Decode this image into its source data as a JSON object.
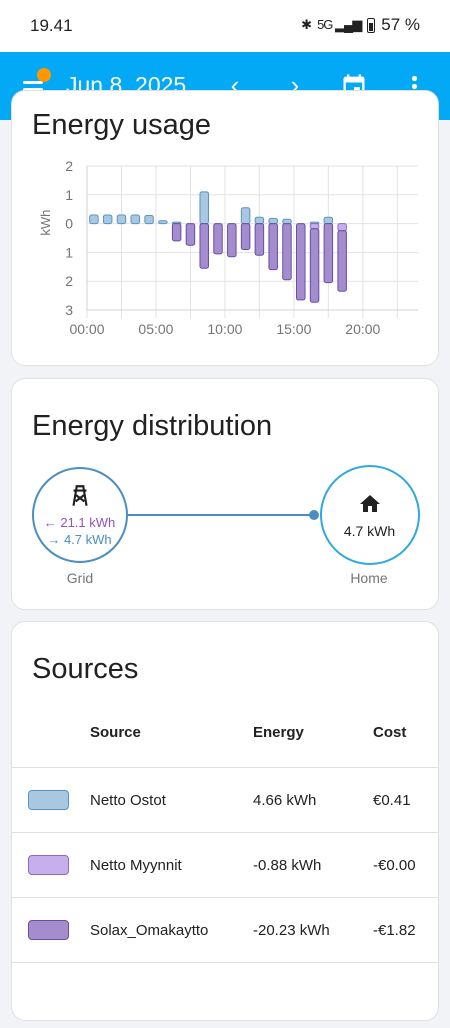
{
  "status_bar": {
    "time": "19.41",
    "network": "5G",
    "battery": "57 %"
  },
  "app_bar": {
    "date": "Jun 8, 2025",
    "prev": "‹",
    "next": "›"
  },
  "energy_usage": {
    "title": "Energy usage",
    "chart_data": {
      "type": "bar",
      "ylabel": "kWh",
      "ylim": [
        -3,
        2
      ],
      "y_ticks": [
        "2",
        "1",
        "0",
        "1",
        "2",
        "3"
      ],
      "x_ticks": [
        "00:00",
        "05:00",
        "10:00",
        "15:00",
        "20:00"
      ],
      "x_hours": [
        0,
        1,
        2,
        3,
        4,
        5,
        6,
        7,
        8,
        9,
        10,
        11,
        12,
        13,
        14,
        15,
        16,
        17,
        18,
        19,
        20,
        21,
        22,
        23
      ],
      "series": [
        {
          "key": "netto_ostot",
          "color": "#a8c8e2",
          "values": [
            0.3,
            0.3,
            0.3,
            0.3,
            0.28,
            0.1,
            0.05,
            0,
            1.1,
            0,
            0,
            0.55,
            0.22,
            0.18,
            0.15,
            0,
            0.05,
            0.22,
            0,
            0,
            0,
            0,
            0,
            0
          ]
        },
        {
          "key": "netto_myynnit",
          "color": "#c6b0ec",
          "values": [
            0,
            0,
            0,
            0,
            0,
            0,
            0,
            0,
            0,
            0,
            0,
            0,
            0,
            0,
            0,
            0,
            -0.18,
            0,
            -0.25,
            0,
            0,
            0,
            0,
            0
          ]
        },
        {
          "key": "solax_omakaytto",
          "color": "#a48dcf",
          "values": [
            0,
            0,
            0,
            0,
            0,
            0,
            -0.6,
            -0.75,
            -1.55,
            -1.05,
            -1.15,
            -0.9,
            -1.1,
            -1.6,
            -1.95,
            -2.65,
            -2.55,
            -2.05,
            -2.1,
            0,
            0,
            0,
            0,
            0
          ]
        }
      ]
    }
  },
  "energy_distribution": {
    "title": "Energy distribution",
    "grid": {
      "label": "Grid",
      "in_value": "← 21.1 kWh",
      "out_value": "→ 4.7 kWh",
      "icon": "transmission-tower-icon"
    },
    "home": {
      "label": "Home",
      "value": "4.7 kWh",
      "icon": "home-icon"
    }
  },
  "sources": {
    "title": "Sources",
    "headers": {
      "source": "Source",
      "energy": "Energy",
      "cost": "Cost"
    },
    "rows": [
      {
        "name": "Netto Ostot",
        "energy": "4.66 kWh",
        "cost": "€0.41",
        "fill": "#a8c8e2",
        "border": "#5b93bf"
      },
      {
        "name": "Netto Myynnit",
        "energy": "-0.88 kWh",
        "cost": "-€0.00",
        "fill": "#c6b0ec",
        "border": "#8d69c9"
      },
      {
        "name": "Solax_Omakaytto",
        "energy": "-20.23 kWh",
        "cost": "-€1.82",
        "fill": "#a48dcf",
        "border": "#6b4da0"
      }
    ]
  }
}
